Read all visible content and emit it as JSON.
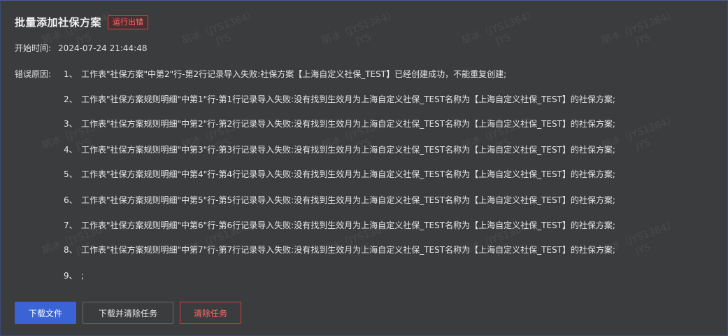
{
  "header": {
    "title": "批量添加社保方案",
    "status_badge": "运行出错"
  },
  "meta": {
    "start_time_label": "开始时间:",
    "start_time_value": "2024-07-24 21:44:48"
  },
  "errors": {
    "label": "错误原因:",
    "items": [
      {
        "num": "1、",
        "text": "工作表\"社保方案\"中第2\"行-第2行记录导入失败:社保方案【上海自定义社保_TEST】已经创建成功，不能重复创建;"
      },
      {
        "num": "2、",
        "text": "工作表\"社保方案规则明细\"中第1\"行-第1行记录导入失败:没有找到生效月为上海自定义社保_TEST名称为【上海自定义社保_TEST】的社保方案;"
      },
      {
        "num": "3、",
        "text": "工作表\"社保方案规则明细\"中第2\"行-第2行记录导入失败:没有找到生效月为上海自定义社保_TEST名称为【上海自定义社保_TEST】的社保方案;"
      },
      {
        "num": "4、",
        "text": "工作表\"社保方案规则明细\"中第3\"行-第3行记录导入失败:没有找到生效月为上海自定义社保_TEST名称为【上海自定义社保_TEST】的社保方案;"
      },
      {
        "num": "5、",
        "text": "工作表\"社保方案规则明细\"中第4\"行-第4行记录导入失败:没有找到生效月为上海自定义社保_TEST名称为【上海自定义社保_TEST】的社保方案;"
      },
      {
        "num": "6、",
        "text": "工作表\"社保方案规则明细\"中第5\"行-第5行记录导入失败:没有找到生效月为上海自定义社保_TEST名称为【上海自定义社保_TEST】的社保方案;"
      },
      {
        "num": "7、",
        "text": "工作表\"社保方案规则明细\"中第6\"行-第6行记录导入失败:没有找到生效月为上海自定义社保_TEST名称为【上海自定义社保_TEST】的社保方案;"
      },
      {
        "num": "8、",
        "text": "工作表\"社保方案规则明细\"中第7\"行-第7行记录导入失败:没有找到生效月为上海自定义社保_TEST名称为【上海自定义社保_TEST】的社保方案;"
      },
      {
        "num": "9、",
        "text": ";"
      }
    ]
  },
  "buttons": {
    "download": "下载文件",
    "download_clear": "下载并清除任务",
    "clear": "清除任务"
  },
  "watermark": {
    "line1": "胡冰（JYS1364）",
    "line2": "JYS"
  },
  "colors": {
    "background": "#3b3c3e",
    "primary": "#3a63d6",
    "danger": "#ff6a6a"
  }
}
